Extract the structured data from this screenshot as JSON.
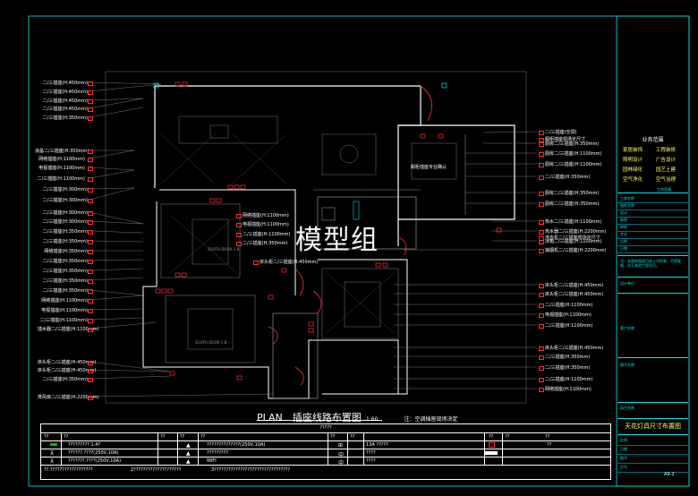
{
  "watermark": "模型组",
  "drawing_title": {
    "plan": "PLAN",
    "name": "插座线路布置图",
    "scale": "1:60",
    "note": "注：空调插座现场决定"
  },
  "left_labels": [
    "二/三插座(H:450mm)",
    "二/三插座(H:450mm)",
    "二/三插座(H:450mm)",
    "二/三插座(H:450mm)",
    "二/三插座(H:350mm)",
    "液晶二/三插座(H:350mm)",
    "网络插座(H:1100mm)",
    "电视插座(H:1100mm)",
    "二/三插座(H:1100mm)",
    "二/三插座(H:300mm)",
    "二/三插座(H:300mm)",
    "二/三插座(H:300mm)",
    "二/三插座(H:300mm)",
    "二/三插座(H:350mm)",
    "二/三插座(H:350mm)",
    "网络插座(H:350mm)",
    "二/三插座(H:350mm)",
    "二/三插座(H:350mm)",
    "二/三插座(H:350mm)",
    "二/三插座(H:350mm)",
    "网络插座(H:1100mm)",
    "电视插座(H:1100mm)",
    "二/三插座(H:1100mm)",
    "插水器二/三插座(H:1100mm)",
    "床头柜二/三插座(H:450mm)",
    "床头柜二/三插座(H:450mm)",
    "二/三插座(H:350mm)",
    "排风扇二/三插座(H:2200mm)"
  ],
  "right_labels": [
    "二/三插座(空调)",
    "橱柜插座现场定尺寸",
    "厨房二/三插座(H:350mm)",
    "厨房二/三插座(H:1100mm)",
    "厨房二/三插座(H:1100mm)",
    "二/三插座(H:350mm)",
    "厨房二/三插座(H:350mm)",
    "厨房二/三插座(H:350mm)",
    "热水二/三插座(H:1100mm)",
    "热水器二/三插座(H:2200mm)",
    "洗衣机二/三插座现场定尺寸",
    "冰箱二/三插座(H:1100mm)",
    "抽烟机二/三插座(H:2200mm)",
    "床头柜二/三插座(H:450mm)",
    "床头柜二/三插座(H:450mm)",
    "二/三插座(H:1100mm)",
    "电视插座(H:1100mm)",
    "二/三插座(H:1100mm)",
    "床头柜二/三插座(H:450mm)",
    "二/三插座(H:350mm)",
    "二/三插座(H:350mm)",
    "二/三插座(H:1100mm)",
    "网络插座(H:1100mm)"
  ],
  "mid_labels": [
    "网络插座(H:1100mm)",
    "电视插座(H:1100mm)",
    "二/三插座(H:1100mm)",
    "二/三插座(H:350mm)",
    "床头柜二/三插座(H:450mm)"
  ],
  "room_labels": {
    "kitchen": "橱柜插座专业确认",
    "bed_tag_1": "SOUTH DOOR 1.8",
    "bed_tag_2": "SOUTH DOOR 1.8"
  },
  "title_block": {
    "heading": "业务范围",
    "services": [
      "家居装饰",
      "工程装修",
      "照明设计",
      "广告设计",
      "园林绿化",
      "园艺土建",
      "空气净化",
      "空气治理"
    ],
    "mid_rows": [
      "工程名称",
      "图纸名称",
      "设计",
      "制图",
      "审核",
      "专业",
      "比例",
      "日期"
    ],
    "stamp": "工作室章",
    "note": "注：本图纸版权归本公司所有，不得复制，用于其他工程项目。",
    "client_label": "设计单位",
    "project_label": "客户名称",
    "drawing_name_label": "图号名称",
    "project_name_label": "项目名称",
    "sheet_title": "天花灯具尺寸布置图",
    "sheet_rows": [
      "比例",
      "日期",
      "图号",
      "页号"
    ],
    "sheet_no": "A9-2"
  },
  "legend": {
    "title": "?????",
    "header": [
      "??",
      "??",
      "??",
      "??",
      "??",
      "??",
      "??",
      "??",
      "??",
      "??"
    ],
    "rows": [
      [
        "?????????  1.4?",
        "??????????????(250V,10A)",
        "13A  ?????",
        "??"
      ],
      [
        "??????.????(250V,10A)",
        "?????????",
        "????",
        ""
      ],
      [
        "???????.????(250V,10A)",
        "WIFI",
        "????",
        ""
      ]
    ],
    "footer": [
      "??.??????????????????",
      "2????????????????????",
      "3????????????????????????????????"
    ]
  },
  "colors": {
    "wall": "#ffffff",
    "cad_line": "#7a7a7a",
    "border": "#00e5e5",
    "outlet": "#ff3030",
    "legend_green": "#00c000"
  }
}
